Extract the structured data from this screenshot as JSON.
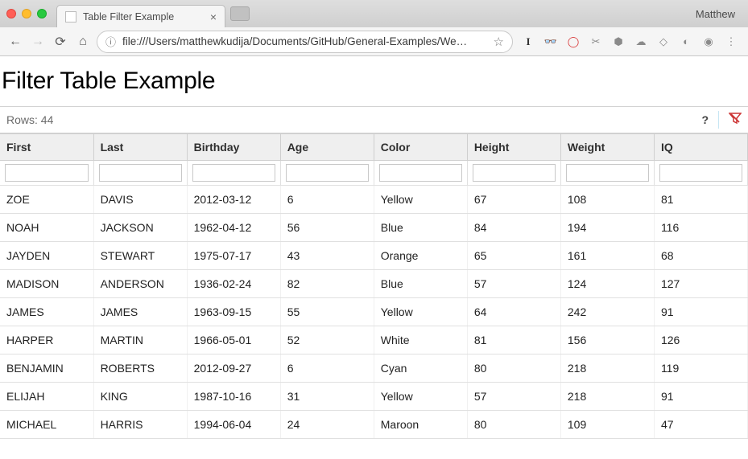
{
  "browser": {
    "profile": "Matthew",
    "tab_title": "Table Filter Example",
    "url": "file:///Users/matthewkudija/Documents/GitHub/General-Examples/We…"
  },
  "page": {
    "heading": "Filter Table Example",
    "row_counter": "Rows: 44",
    "help_label": "?",
    "columns": [
      {
        "key": "first",
        "label": "First"
      },
      {
        "key": "last",
        "label": "Last"
      },
      {
        "key": "birthday",
        "label": "Birthday"
      },
      {
        "key": "age",
        "label": "Age"
      },
      {
        "key": "color",
        "label": "Color"
      },
      {
        "key": "height",
        "label": "Height"
      },
      {
        "key": "weight",
        "label": "Weight"
      },
      {
        "key": "iq",
        "label": "IQ"
      }
    ],
    "rows": [
      {
        "first": "ZOE",
        "last": "DAVIS",
        "birthday": "2012-03-12",
        "age": "6",
        "color": "Yellow",
        "height": "67",
        "weight": "108",
        "iq": "81"
      },
      {
        "first": "NOAH",
        "last": "JACKSON",
        "birthday": "1962-04-12",
        "age": "56",
        "color": "Blue",
        "height": "84",
        "weight": "194",
        "iq": "116"
      },
      {
        "first": "JAYDEN",
        "last": "STEWART",
        "birthday": "1975-07-17",
        "age": "43",
        "color": "Orange",
        "height": "65",
        "weight": "161",
        "iq": "68"
      },
      {
        "first": "MADISON",
        "last": "ANDERSON",
        "birthday": "1936-02-24",
        "age": "82",
        "color": "Blue",
        "height": "57",
        "weight": "124",
        "iq": "127"
      },
      {
        "first": "JAMES",
        "last": "JAMES",
        "birthday": "1963-09-15",
        "age": "55",
        "color": "Yellow",
        "height": "64",
        "weight": "242",
        "iq": "91"
      },
      {
        "first": "HARPER",
        "last": "MARTIN",
        "birthday": "1966-05-01",
        "age": "52",
        "color": "White",
        "height": "81",
        "weight": "156",
        "iq": "126"
      },
      {
        "first": "BENJAMIN",
        "last": "ROBERTS",
        "birthday": "2012-09-27",
        "age": "6",
        "color": "Cyan",
        "height": "80",
        "weight": "218",
        "iq": "119"
      },
      {
        "first": "ELIJAH",
        "last": "KING",
        "birthday": "1987-10-16",
        "age": "31",
        "color": "Yellow",
        "height": "57",
        "weight": "218",
        "iq": "91"
      },
      {
        "first": "MICHAEL",
        "last": "HARRIS",
        "birthday": "1994-06-04",
        "age": "24",
        "color": "Maroon",
        "height": "80",
        "weight": "109",
        "iq": "47"
      }
    ]
  }
}
